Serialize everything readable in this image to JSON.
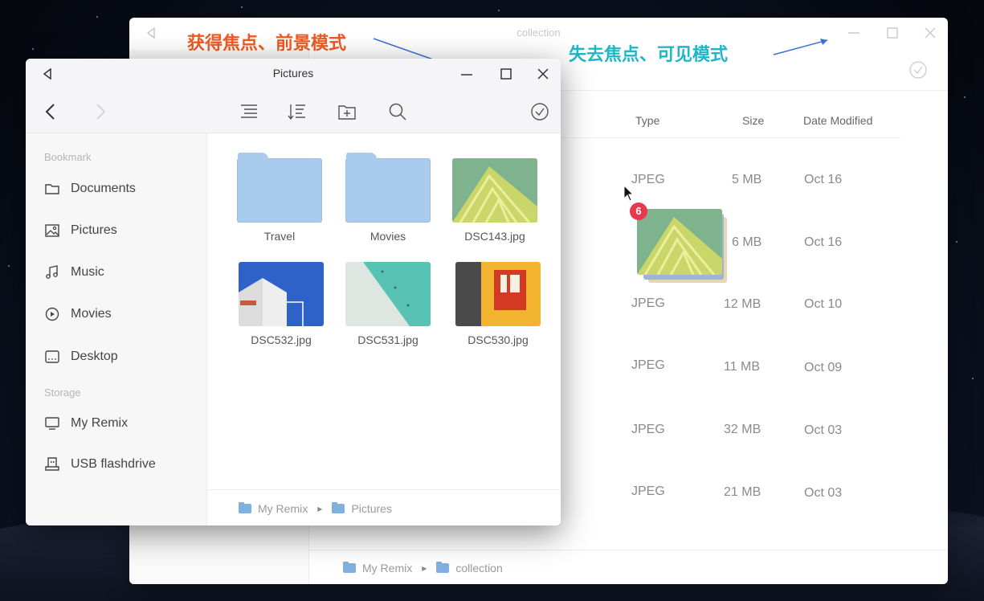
{
  "annotations": {
    "focused": "获得焦点、前景模式",
    "unfocused": "失去焦点、可见模式"
  },
  "back_window": {
    "title": "collection",
    "columns": {
      "type": "Type",
      "size": "Size",
      "date": "Date Modified"
    },
    "rows": [
      {
        "type": "JPEG",
        "size": "5 MB",
        "date": "Oct 16"
      },
      {
        "type": "",
        "size": "6 MB",
        "date": "Oct 16"
      },
      {
        "type": "JPEG",
        "size": "12 MB",
        "date": "Oct 10"
      },
      {
        "type": "JPEG",
        "size": "11 MB",
        "date": "Oct 09"
      },
      {
        "type": "JPEG",
        "size": "32 MB",
        "date": "Oct 03"
      },
      {
        "type": "JPEG",
        "size": "21 MB",
        "date": "Oct 03"
      }
    ],
    "breadcrumb": [
      "My Remix",
      "collection"
    ]
  },
  "front_window": {
    "title": "Pictures",
    "sidebar": {
      "bookmark_label": "Bookmark",
      "storage_label": "Storage",
      "bookmarks": [
        {
          "label": "Documents",
          "icon": "folder-icon"
        },
        {
          "label": "Pictures",
          "icon": "image-icon"
        },
        {
          "label": "Music",
          "icon": "music-icon"
        },
        {
          "label": "Movies",
          "icon": "play-icon"
        },
        {
          "label": "Desktop",
          "icon": "desktop-icon"
        }
      ],
      "storage": [
        {
          "label": "My Remix",
          "icon": "monitor-icon"
        },
        {
          "label": "USB flashdrive",
          "icon": "usb-icon"
        }
      ]
    },
    "files": [
      {
        "name": "Travel",
        "kind": "folder"
      },
      {
        "name": "Movies",
        "kind": "folder"
      },
      {
        "name": "DSC143.jpg",
        "kind": "image"
      },
      {
        "name": "DSC532.jpg",
        "kind": "image"
      },
      {
        "name": "DSC531.jpg",
        "kind": "image"
      },
      {
        "name": "DSC530.jpg",
        "kind": "image"
      }
    ],
    "breadcrumb": [
      "My Remix",
      "Pictures"
    ]
  },
  "drag": {
    "count": "6"
  },
  "colors": {
    "accent_orange": "#ee5a24",
    "accent_teal": "#1fb7c8",
    "folder_blue": "#a8cbee",
    "badge_red": "#e8384f"
  }
}
